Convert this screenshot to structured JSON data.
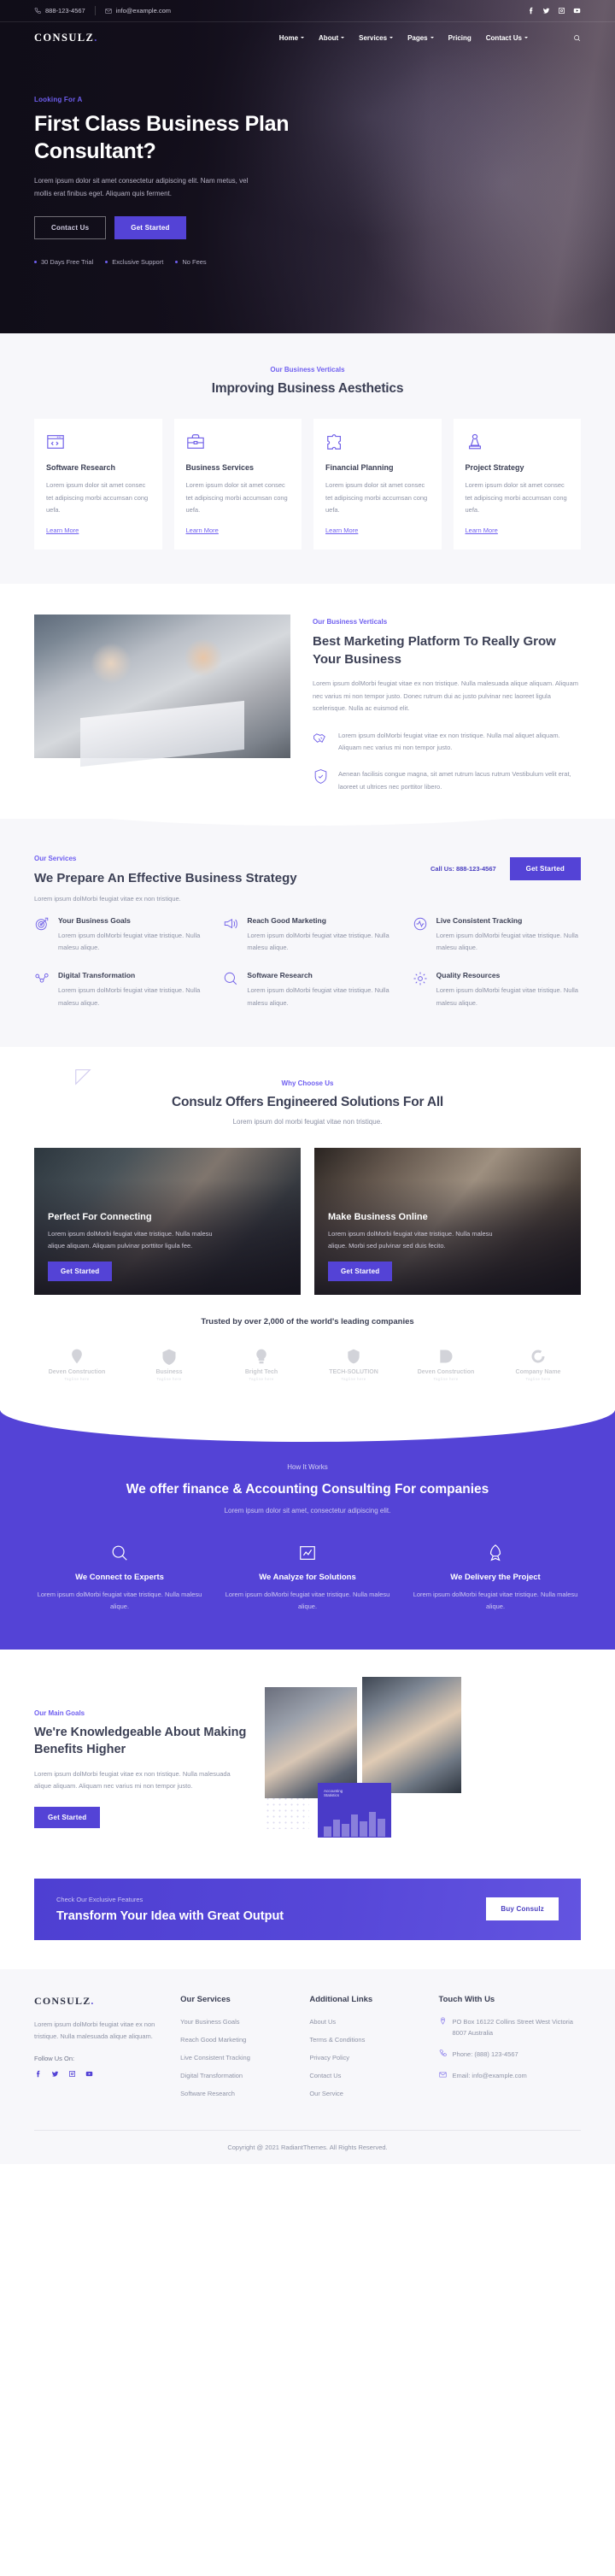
{
  "topbar": {
    "phone": "888-123-4567",
    "email": "info@example.com",
    "social": [
      "facebook-icon",
      "twitter-icon",
      "instagram-icon",
      "youtube-icon"
    ]
  },
  "nav": {
    "logo": "CONSULZ",
    "logo_dot": ".",
    "items": [
      {
        "label": "Home",
        "has_caret": true
      },
      {
        "label": "About",
        "has_caret": true
      },
      {
        "label": "Services",
        "has_caret": true
      },
      {
        "label": "Pages",
        "has_caret": true
      },
      {
        "label": "Pricing",
        "has_caret": false
      },
      {
        "label": "Contact Us",
        "has_caret": true
      }
    ],
    "search_icon": "search-icon"
  },
  "hero": {
    "eyebrow": "Looking For A",
    "title": "First Class Business Plan Consultant?",
    "paragraph": "Lorem ipsum dolor sit amet consectetur adipiscing elit. Nam metus, vel mollis erat finibus eget. Aliquam quis ferment.",
    "btn_secondary": "Contact Us",
    "btn_primary": "Get Started",
    "meta": [
      "30 Days Free Trial",
      "Exclusive Support",
      "No Fees"
    ]
  },
  "verticals": {
    "label": "Our Business Verticals",
    "title": "Improving Business Aesthetics",
    "cards": [
      {
        "icon": "code-window-icon",
        "title": "Software Research",
        "text": "Lorem ipsum dolor sit amet consec tet adipiscing morbi accumsan cong uefa.",
        "link": "Learn More"
      },
      {
        "icon": "briefcase-icon",
        "title": "Business Services",
        "text": "Lorem ipsum dolor sit amet consec tet adipiscing morbi accumsan cong uefa.",
        "link": "Learn More"
      },
      {
        "icon": "puzzle-icon",
        "title": "Financial Planning",
        "text": "Lorem ipsum dolor sit amet consec tet adipiscing morbi accumsan cong uefa.",
        "link": "Learn More"
      },
      {
        "icon": "chess-pawn-icon",
        "title": "Project Strategy",
        "text": "Lorem ipsum dolor sit amet consec tet adipiscing morbi accumsan cong uefa.",
        "link": "Learn More"
      }
    ]
  },
  "platform": {
    "label": "Our Business Verticals",
    "title": "Best Marketing Platform To Really Grow Your Business",
    "paragraph": "Lorem ipsum dolMorbi feugiat vitae ex non tristique. Nulla malesuada alique aliquam. Aliquam nec varius mi non tempor justo. Donec rutrum dui ac justo pulvinar nec laoreet ligula scelerisque. Nulla ac euismod elit.",
    "features": [
      {
        "icon": "handshake-icon",
        "text": "Lorem ipsum dolMorbi feugiat vitae ex non tristique. Nulla mal aliquet aliquam. Aliquam nec varius mi non tempor justo."
      },
      {
        "icon": "shield-icon",
        "text": "Aenean facilisis congue magna, sit amet rutrum lacus rutrum Vestibulum velit erat, laoreet ut ultrices nec porttitor libero."
      }
    ]
  },
  "strategy": {
    "label": "Our Services",
    "title": "We Prepare An Effective Business Strategy",
    "paragraph": "Lorem ipsum dolMorbi feugiat vitae ex non tristique.",
    "call_us": "Call Us: 888-123-4567",
    "btn": "Get Started",
    "services": [
      {
        "icon": "target-icon",
        "title": "Your Business Goals",
        "text": "Lorem ipsum dolMorbi feugiat vitae tristique. Nulla malesu alique."
      },
      {
        "icon": "megaphone-icon",
        "title": "Reach Good Marketing",
        "text": "Lorem ipsum dolMorbi feugiat vitae tristique. Nulla malesu alique."
      },
      {
        "icon": "pulse-icon",
        "title": "Live Consistent Tracking",
        "text": "Lorem ipsum dolMorbi feugiat vitae tristique. Nulla malesu alique."
      },
      {
        "icon": "network-icon",
        "title": "Digital Transformation",
        "text": "Lorem ipsum dolMorbi feugiat vitae tristique. Nulla malesu alique."
      },
      {
        "icon": "search-circle-icon",
        "title": "Software Research",
        "text": "Lorem ipsum dolMorbi feugiat vitae tristique. Nulla malesu alique."
      },
      {
        "icon": "gear-icon",
        "title": "Quality Resources",
        "text": "Lorem ipsum dolMorbi feugiat vitae tristique. Nulla malesu alique."
      }
    ]
  },
  "choose": {
    "label": "Why Choose Us",
    "title": "Consulz Offers Engineered Solutions For All",
    "sub": "Lorem ipsum dol morbi feugiat vitae non tristique.",
    "cards": [
      {
        "title": "Perfect For Connecting",
        "text": "Lorem ipsum dolMorbi feugiat vitae tristique. Nulla malesu alique aliquam. Aliquam pulvinar porttitor ligula fee.",
        "btn": "Get Started"
      },
      {
        "title": "Make Business Online",
        "text": "Lorem ipsum dolMorbi feugiat vitae tristique. Nulla malesu alique. Morbi sed pulvinar sed duis fecito.",
        "btn": "Get Started"
      }
    ]
  },
  "trusted": {
    "title": "Trusted by over 2,000 of the world's leading companies",
    "logos": [
      {
        "mark": "pin-logo-icon",
        "name": "Deven Construction",
        "tag": "Tagline here"
      },
      {
        "mark": "shield-a-logo-icon",
        "name": "Business",
        "tag": "Tagline here"
      },
      {
        "mark": "bulb-logo-icon",
        "name": "Bright Tech",
        "tag": "Tagline here"
      },
      {
        "mark": "shield-logo-icon",
        "name": "TECH-SOLUTION",
        "tag": "Tagline here"
      },
      {
        "mark": "d-logo-icon",
        "name": "Deven Construction",
        "tag": "Tagline here"
      },
      {
        "mark": "swirl-logo-icon",
        "name": "Company Name",
        "tag": "Tagline here"
      }
    ]
  },
  "how": {
    "label": "How It Works",
    "title": "We offer finance & Accounting Consulting For companies",
    "sub": "Lorem ipsum dolor sit amet, consectetur adipiscing elit.",
    "steps": [
      {
        "icon": "search-icon",
        "title": "We Connect to Experts",
        "text": "Lorem ipsum dolMorbi feugiat vitae tristique. Nulla malesu alique."
      },
      {
        "icon": "chart-icon",
        "title": "We Analyze for Solutions",
        "text": "Lorem ipsum dolMorbi feugiat vitae tristique. Nulla malesu alique."
      },
      {
        "icon": "rocket-icon",
        "title": "We Delivery the Project",
        "text": "Lorem ipsum dolMorbi feugiat vitae tristique. Nulla malesu alique."
      }
    ]
  },
  "know": {
    "label": "Our Main Goals",
    "title": "We're Knowledgeable About Making Benefits Higher",
    "paragraph": "Lorem ipsum dolMorbi feugiat vitae ex non tristique. Nulla malesuada alique aliquam. Aliquam nec varius mi non tempor justo.",
    "btn": "Get Started",
    "widget_title": "Accounting",
    "widget_sub": "Statistics"
  },
  "cta": {
    "label": "Check Our Exclusive Features",
    "title": "Transform Your Idea with Great Output",
    "btn": "Buy Consulz"
  },
  "footer": {
    "logo": "CONSULZ",
    "logo_dot": ".",
    "description": "Lorem ipsum dolMorbi feugiat vitae ex non tristique. Nulla malesuada alique aliquam.",
    "follow_label": "Follow Us On:",
    "social": [
      "facebook-icon",
      "twitter-icon",
      "instagram-icon",
      "youtube-icon"
    ],
    "services_heading": "Our Services",
    "services": [
      "Your Business Goals",
      "Reach Good Marketing",
      "Live Consistent Tracking",
      "Digital Transformation",
      "Software Research"
    ],
    "links_heading": "Additional Links",
    "links": [
      "About Us",
      "Terms & Conditions",
      "Privacy Policy",
      "Contact Us",
      "Our Service"
    ],
    "touch_heading": "Touch With Us",
    "address": "PO Box 16122 Collins Street West Victoria 8007 Australia",
    "phone": "Phone: (888) 123-4567",
    "email": "Email: info@example.com",
    "copyright": "Copyright @ 2021 RadiantThemes. All Rights Reserved."
  },
  "colors": {
    "accent": "#5443d6",
    "accent_light": "#6f5ff0",
    "dark": "#3c4055",
    "muted": "#8e93a6"
  }
}
